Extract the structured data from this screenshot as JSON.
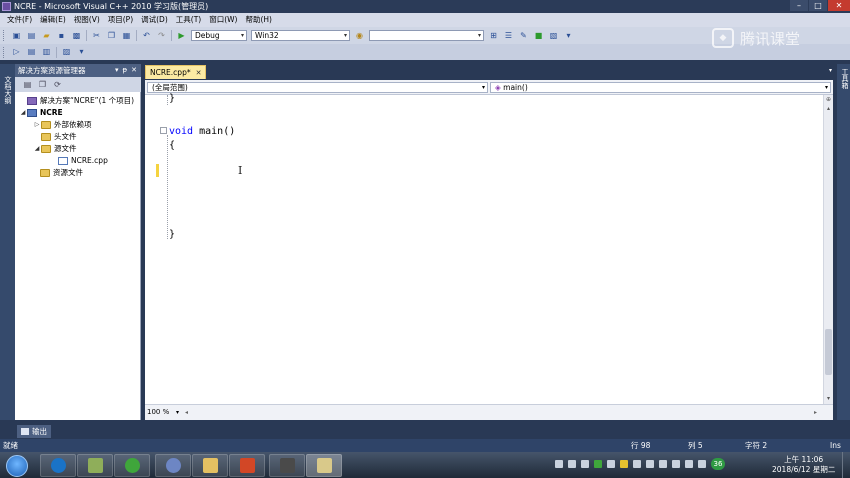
{
  "window": {
    "title": "NCRE - Microsoft Visual C++ 2010 学习版(管理员)",
    "buttons": {
      "minimize": "–",
      "maximize": "□",
      "close": "✕"
    }
  },
  "menu": [
    "文件(F)",
    "编辑(E)",
    "视图(V)",
    "项目(P)",
    "调试(D)",
    "工具(T)",
    "窗口(W)",
    "帮助(H)"
  ],
  "toolbar": {
    "configuration": "Debug",
    "platform": "Win32",
    "find_value": ""
  },
  "brand": {
    "text": "腾讯课堂"
  },
  "side_tabs": {
    "left": "文档大纲",
    "right": "工具箱"
  },
  "solution_explorer": {
    "title": "解决方案资源管理器",
    "header_buttons": [
      "▾",
      "ᵽ",
      "✕"
    ],
    "tree": [
      {
        "label": "解决方案“NCRE”(1 个项目)",
        "icon": "solution-icon",
        "expander": ""
      },
      {
        "label": "NCRE",
        "icon": "project-icon",
        "expander": "◢"
      },
      {
        "label": "外部依赖项",
        "icon": "folder-icon",
        "expander": "▷"
      },
      {
        "label": "头文件",
        "icon": "folder-icon",
        "expander": ""
      },
      {
        "label": "源文件",
        "icon": "folder-icon",
        "expander": "◢"
      },
      {
        "label": "NCRE.cpp",
        "icon": "cpp-file-icon",
        "expander": ""
      },
      {
        "label": "资源文件",
        "icon": "folder-icon",
        "expander": ""
      }
    ]
  },
  "editor": {
    "tab": {
      "label": "NCRE.cpp*",
      "close": "✕"
    },
    "scope_combo": "(全局范围)",
    "member_combo": "main()",
    "code": {
      "prev_close": "}",
      "keyword": "void",
      "signature": " main()",
      "open_brace": "{",
      "close_brace": "}",
      "collapse_glyph": "⊟"
    },
    "zoom": "100 %"
  },
  "output_tab": {
    "label": "输出"
  },
  "status": {
    "left": "就绪",
    "line": "行 98",
    "column": "列 5",
    "char": "字符 2",
    "mode": "Ins"
  },
  "taskbar": {
    "apps": [
      "k-app-icon",
      "folder-app-icon",
      "browser-icon",
      "avatar-app-icon",
      "explorer-icon",
      "powerpoint-icon",
      "media-icon",
      "visual-studio-icon"
    ],
    "tray_badge": "36",
    "time": "上午 11:06",
    "date": "2018/6/12 星期二"
  }
}
